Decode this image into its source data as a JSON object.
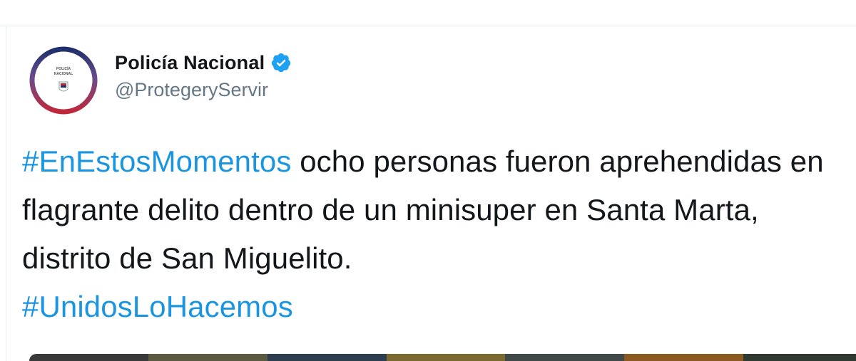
{
  "author": {
    "display_name": "Policía Nacional",
    "handle": "@ProtegeryServir",
    "verified": true,
    "avatar_text": "POLICÍA NACIONAL"
  },
  "tweet": {
    "hashtag_1": "#EnEstosMomentos",
    "body_1": " ocho personas fueron aprehendidas en flagrante delito dentro de un minisuper en Santa Marta, distrito de San Miguelito.",
    "hashtag_2": "#UnidosLoHacemos"
  },
  "colors": {
    "hashtag": "#1b95e0",
    "verified_badge": "#1da1f2",
    "avatar_ring_top": "#1f2f6b",
    "avatar_ring_bottom": "#c0283a"
  },
  "icons": {
    "verified": "verified-badge-icon",
    "avatar": "police-shield-logo"
  }
}
